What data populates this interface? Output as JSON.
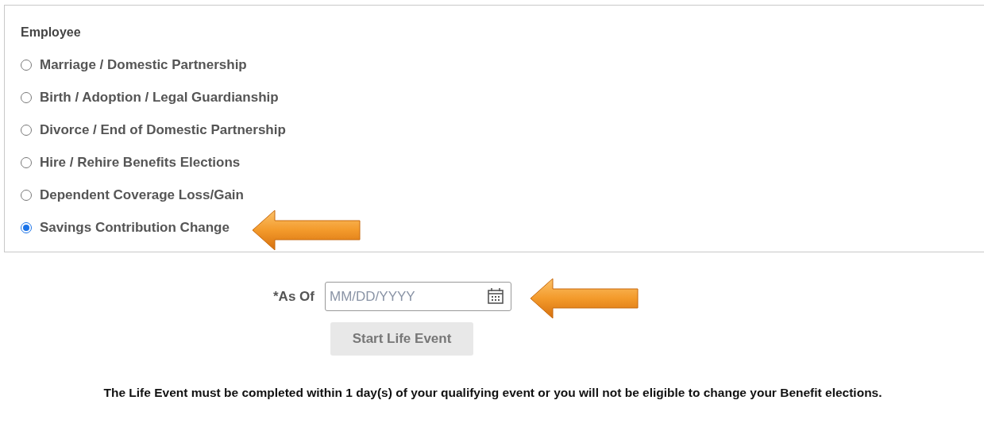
{
  "section": {
    "title": "Employee",
    "options": [
      {
        "label": "Marriage / Domestic Partnership",
        "selected": false
      },
      {
        "label": "Birth / Adoption / Legal Guardianship",
        "selected": false
      },
      {
        "label": "Divorce / End of Domestic Partnership",
        "selected": false
      },
      {
        "label": "Hire / Rehire Benefits Elections",
        "selected": false
      },
      {
        "label": "Dependent Coverage Loss/Gain",
        "selected": false
      },
      {
        "label": "Savings Contribution Change",
        "selected": true
      }
    ]
  },
  "date_field": {
    "label": "*As Of",
    "placeholder": "MM/DD/YYYY"
  },
  "start_button": {
    "label": "Start Life Event",
    "disabled": true
  },
  "notice": "The Life Event must be completed within 1 day(s) of your qualifying event or you will not be eligible to change your Benefit elections."
}
